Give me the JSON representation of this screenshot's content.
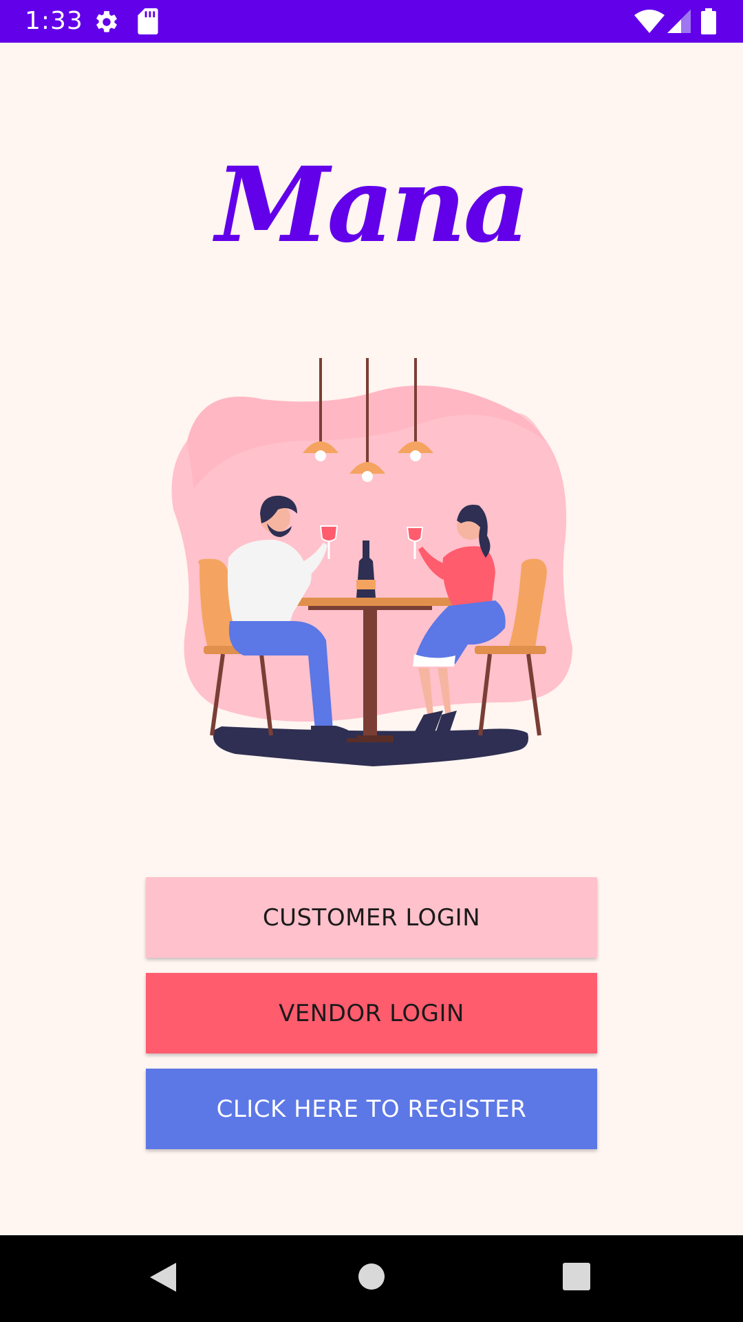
{
  "status_bar": {
    "time": "1:33",
    "background_color": "#6200EA",
    "left_icons": [
      "gear-icon",
      "sd-card-icon"
    ],
    "right_icons": [
      "wifi-icon",
      "signal-icon",
      "battery-icon"
    ]
  },
  "app": {
    "name": "Mana",
    "brand_color": "#6200EA",
    "background_color": "#FFF5F1",
    "illustration": "couple dining at table under pendant lamps"
  },
  "buttons": {
    "customer_login": {
      "label": "CUSTOMER LOGIN",
      "color": "#FFC1CB"
    },
    "vendor_login": {
      "label": "VENDOR LOGIN",
      "color": "#FF5C6E"
    },
    "register": {
      "label": "CLICK HERE TO REGISTER",
      "color": "#5C77E6"
    }
  },
  "nav_bar": {
    "icons": [
      "back-icon",
      "home-icon",
      "recents-icon"
    ]
  }
}
